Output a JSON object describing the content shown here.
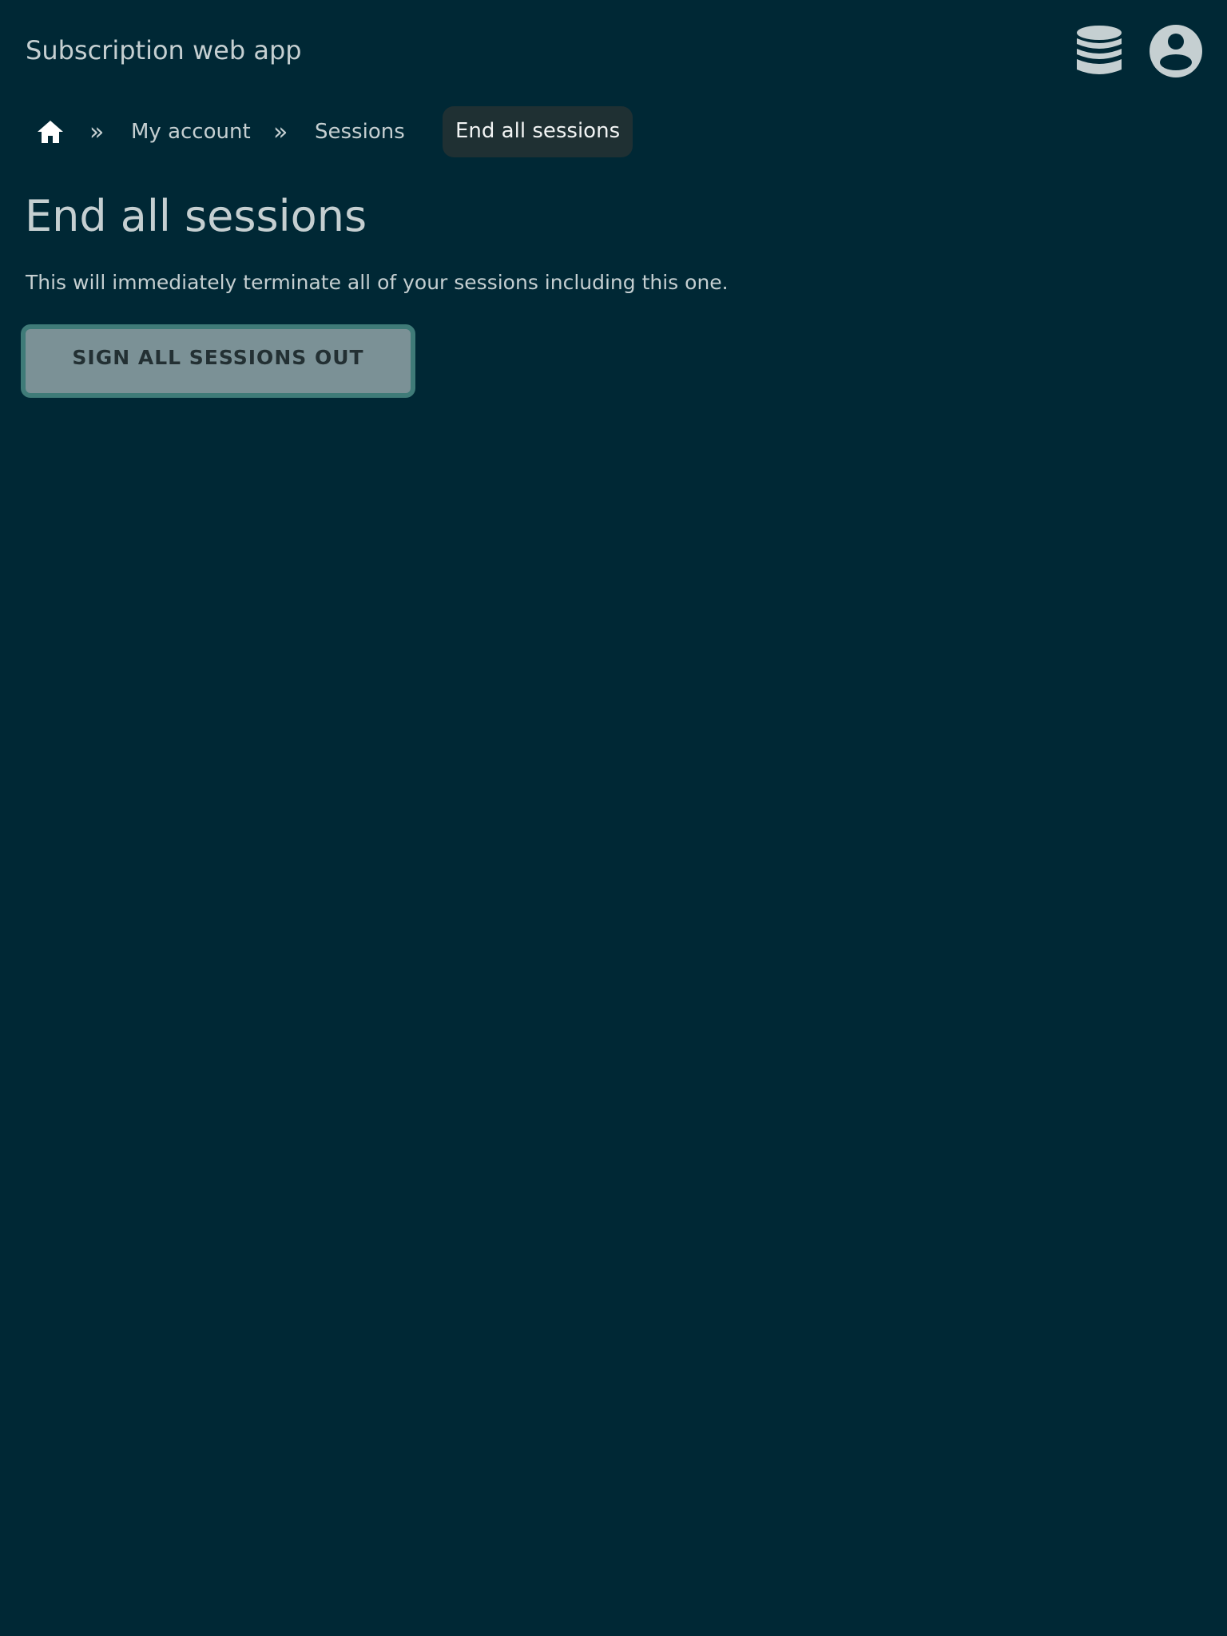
{
  "header": {
    "app_title": "Subscription web app",
    "icons": [
      "database-icon",
      "user-circle-icon"
    ]
  },
  "breadcrumb": {
    "home_icon": "home-icon",
    "separator": "»",
    "items": [
      {
        "label": "My account"
      },
      {
        "label": "Sessions"
      }
    ],
    "current": "End all sessions"
  },
  "main": {
    "title": "End all sessions",
    "description": "This will immediately terminate all of your sessions including this one.",
    "action_label": "SIGN ALL SESSIONS OUT"
  },
  "colors": {
    "background": "#002835",
    "text": "#c5cfd1",
    "current_crumb_bg": "#1f3033",
    "button_bg": "#7b9196",
    "button_border": "#3f7b78",
    "button_text": "#233033"
  }
}
